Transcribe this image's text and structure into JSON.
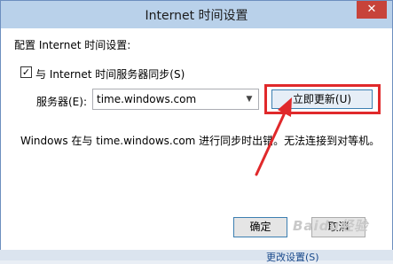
{
  "window": {
    "title": "Internet 时间设置",
    "close_label": "✕"
  },
  "section_label": "配置 Internet 时间设置:",
  "sync": {
    "checked": true,
    "checkmark": "✓",
    "label": "与 Internet 时间服务器同步(S)"
  },
  "server": {
    "label": "服务器(E):",
    "value": "time.windows.com"
  },
  "update_button": "立即更新(U)",
  "status_text": "Windows 在与 time.windows.com 进行同步时出错。无法连接到对等机。",
  "ok_button": "确定",
  "cancel_button": "取消",
  "background_link": "更改设置(S)",
  "watermark": "Baidu经验",
  "colors": {
    "highlight": "#e0292b",
    "titlebar": "#b9d1ea"
  }
}
